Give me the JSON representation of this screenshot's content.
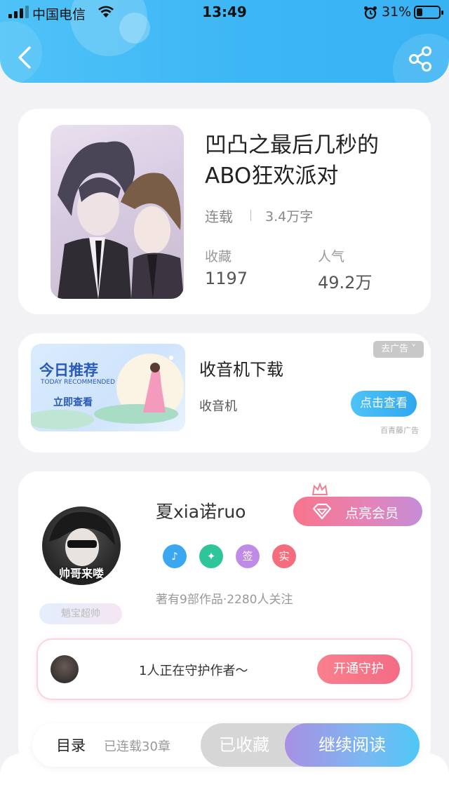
{
  "status_bar": {
    "carrier": "中国电信",
    "time": "13:49",
    "battery_percent": "31%"
  },
  "colors": {
    "header": "#3db6f5",
    "accent_pink": "#f36c84",
    "accent_blue": "#4fc3f7"
  },
  "icons": {
    "back": "back-arrow-icon",
    "share": "share-icon",
    "vip": "diamond-icon"
  },
  "book": {
    "title": "凹凸之最后几秒的ABO狂欢派对",
    "status": "连载",
    "word_count": "3.4万字",
    "favorites_label": "收藏",
    "favorites_value": "1197",
    "popularity_label": "人气",
    "popularity_value": "49.2万"
  },
  "ad": {
    "image_title": "今日推荐",
    "image_subtitle": "TODAY RECOMMENDED",
    "image_cta": "立即查看",
    "title": "收音机下载",
    "subtitle": "收音机",
    "close_label": "去广告",
    "cta_label": "点击查看",
    "source": "百青藤广告"
  },
  "author": {
    "name": "夏xia诺ruo",
    "avatar_text": "帅哥来喽",
    "avatar_badge": "魈宝超帅",
    "vip_button": "点亮会员",
    "badges": [
      {
        "label": "♪",
        "color": "#3ba7f0"
      },
      {
        "label": "✦",
        "color": "#2fc59a"
      },
      {
        "label": "签",
        "color": "#c08be6"
      },
      {
        "label": "实",
        "color": "#f46c7e"
      }
    ],
    "meta": "著有9部作品·2280人关注",
    "guard_text": "1人正在守护作者～",
    "guard_button": "开通守护"
  },
  "bottom_bar": {
    "toc_label": "目录",
    "chapters": "已连载30章",
    "collected_label": "已收藏",
    "read_label": "继续阅读"
  }
}
